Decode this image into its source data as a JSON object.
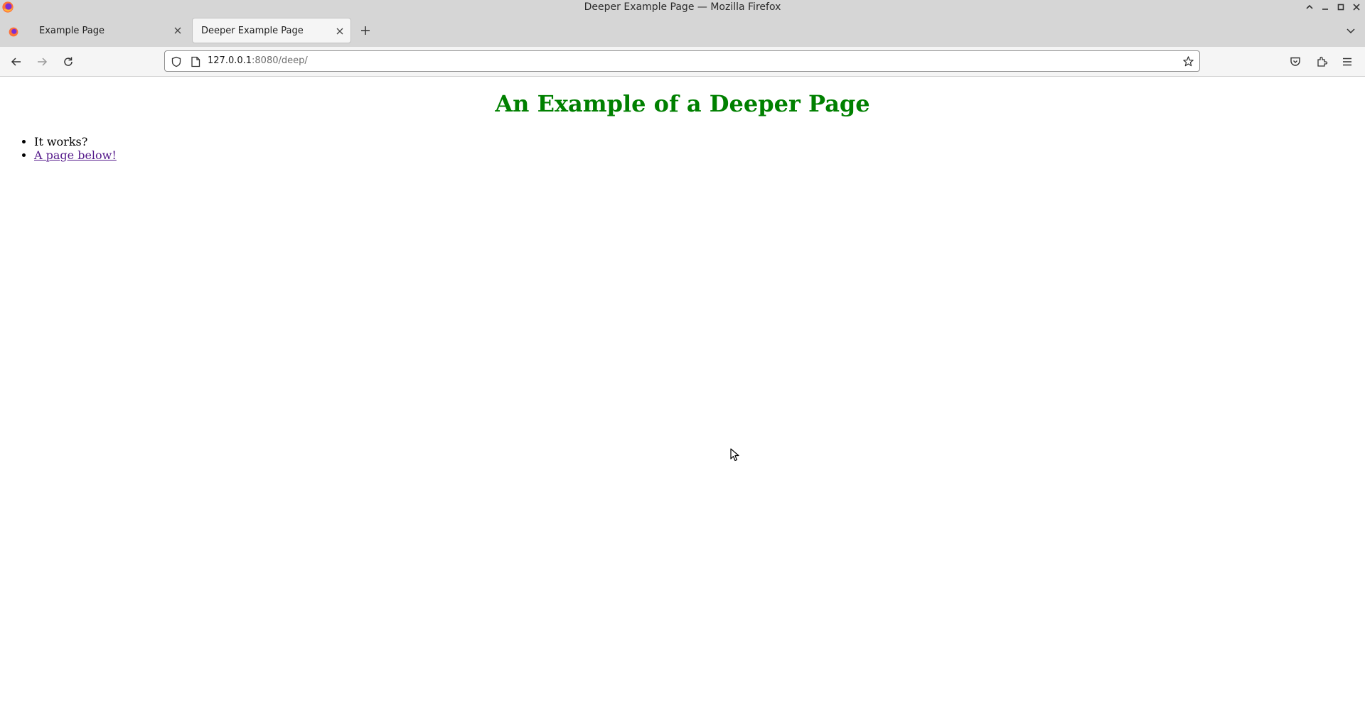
{
  "window": {
    "title": "Deeper Example Page — Mozilla Firefox"
  },
  "tabs": [
    {
      "label": "Example Page",
      "active": false
    },
    {
      "label": "Deeper Example Page",
      "active": true
    }
  ],
  "navbar": {
    "url_host": "127.0.0.1",
    "url_rest": ":8080/deep/"
  },
  "page": {
    "heading": "An Example of a Deeper Page",
    "list_items": [
      {
        "text": "It works?",
        "link": false
      },
      {
        "text": "A page below!",
        "link": true
      }
    ],
    "heading_color": "#008000",
    "link_color": "#551a8b"
  },
  "icons": {
    "app": "firefox-icon",
    "back": "back-arrow-icon",
    "forward": "forward-arrow-icon",
    "reload": "reload-icon",
    "shield": "shield-icon",
    "page": "page-icon",
    "star": "star-icon",
    "pocket": "pocket-icon",
    "extensions": "extensions-icon",
    "menu": "hamburger-menu-icon"
  }
}
